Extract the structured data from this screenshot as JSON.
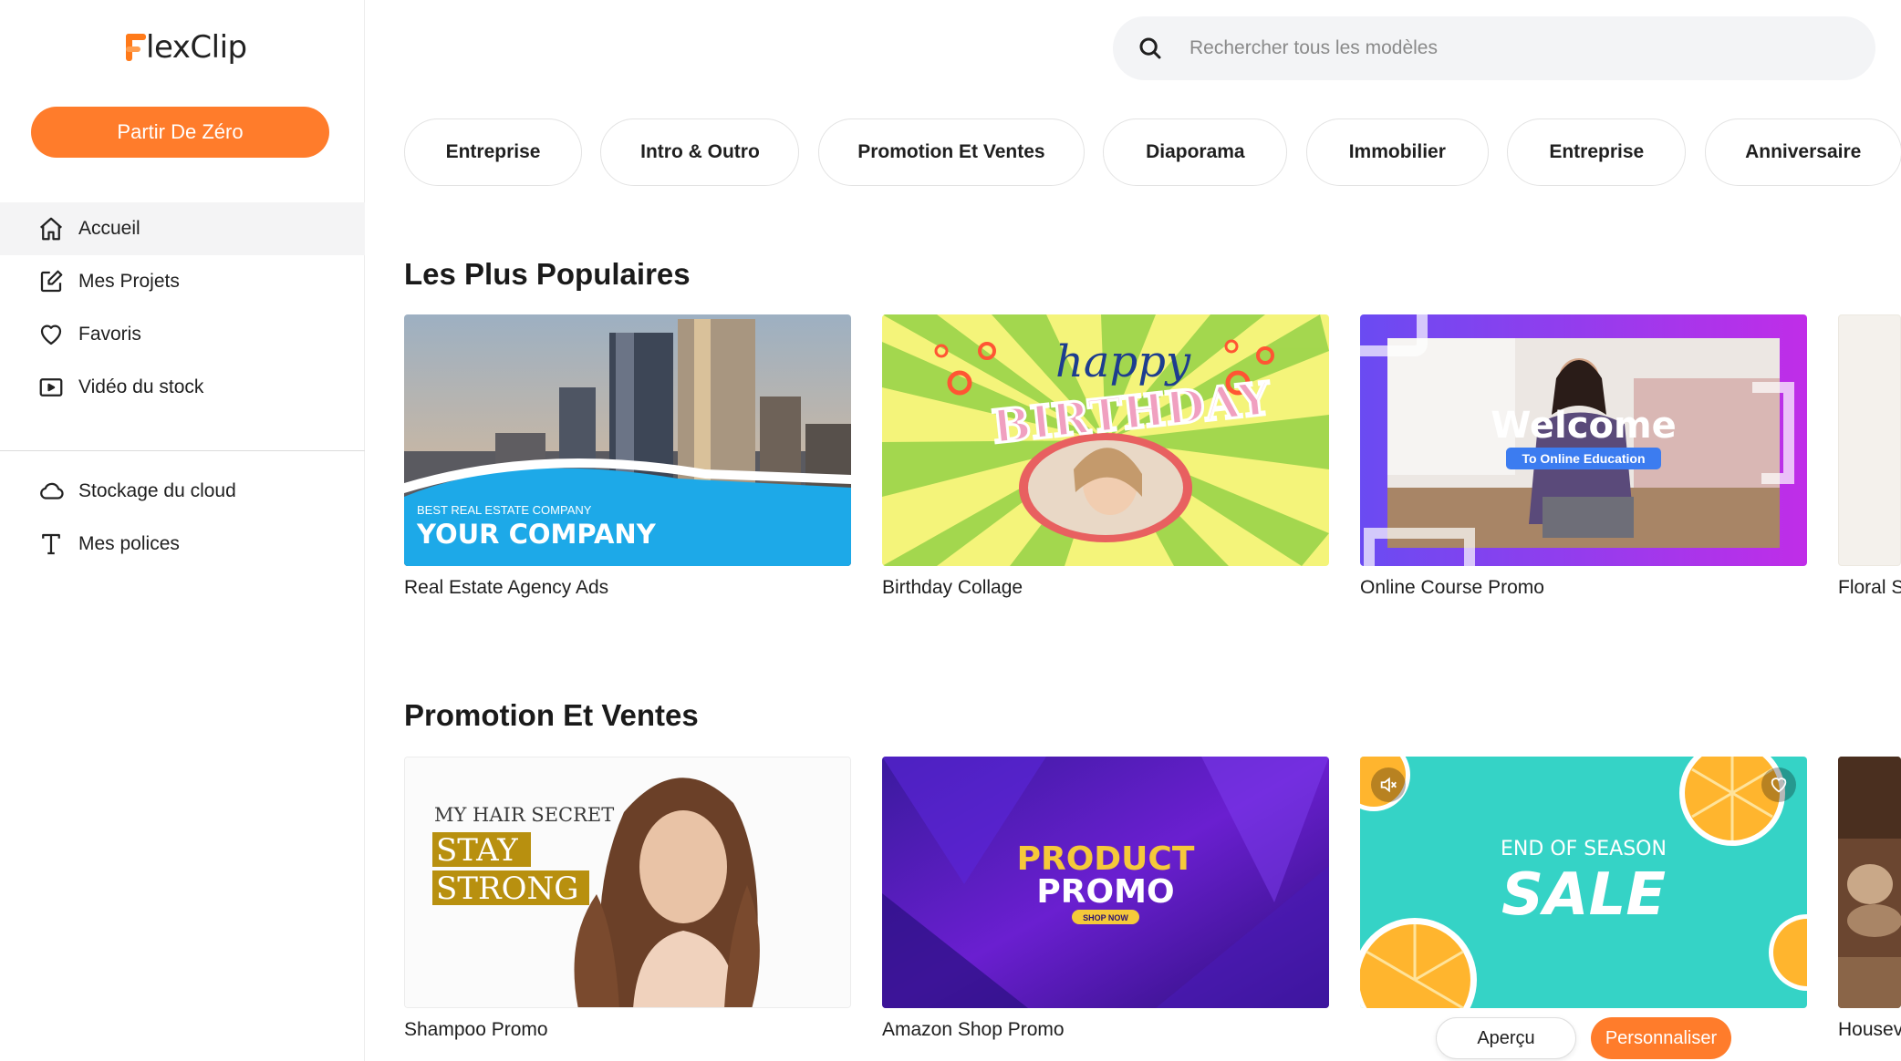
{
  "app": {
    "logo_text": "lexClip",
    "brand_color": "#ff7c2b"
  },
  "sidebar": {
    "start_button": "Partir De Zéro",
    "items": [
      {
        "label": "Accueil",
        "icon": "home-icon",
        "active": true
      },
      {
        "label": "Mes Projets",
        "icon": "edit-icon"
      },
      {
        "label": "Favoris",
        "icon": "heart-icon"
      },
      {
        "label": "Vidéo du stock",
        "icon": "video-icon"
      }
    ],
    "items2": [
      {
        "label": "Stockage du cloud",
        "icon": "cloud-icon"
      },
      {
        "label": "Mes polices",
        "icon": "font-icon"
      }
    ]
  },
  "search": {
    "placeholder": "Rechercher tous les modèles"
  },
  "categories": [
    "Entreprise",
    "Intro & Outro",
    "Promotion Et Ventes",
    "Diaporama",
    "Immobilier",
    "Entreprise",
    "Anniversaire"
  ],
  "sections": [
    {
      "title": "Les Plus Populaires",
      "cards": [
        {
          "title": "Real Estate Agency Ads",
          "thumb_sub": "BEST REAL ESTATE COMPANY",
          "thumb_main": "YOUR COMPANY"
        },
        {
          "title": "Birthday Collage",
          "thumb_script": "happy",
          "thumb_main": "BIRTHDAY"
        },
        {
          "title": "Online Course Promo",
          "thumb_main": "Welcome",
          "thumb_sub": "To Online Education"
        },
        {
          "title": "Floral S"
        }
      ]
    },
    {
      "title": "Promotion Et Ventes",
      "cards": [
        {
          "title": "Shampoo Promo",
          "thumb_sub": "MY HAIR SECRET",
          "thumb_main1": "STAY",
          "thumb_main2": "STRONG"
        },
        {
          "title": "Amazon Shop Promo",
          "thumb_main1": "PRODUCT",
          "thumb_main2": "PROMO",
          "thumb_sub": "SHOP NOW"
        },
        {
          "title": "",
          "thumb_sub": "END OF SEASON",
          "thumb_main": "SALE"
        },
        {
          "title": "Housev"
        }
      ]
    }
  ],
  "hover_actions": {
    "preview": "Aperçu",
    "customize": "Personnaliser"
  }
}
